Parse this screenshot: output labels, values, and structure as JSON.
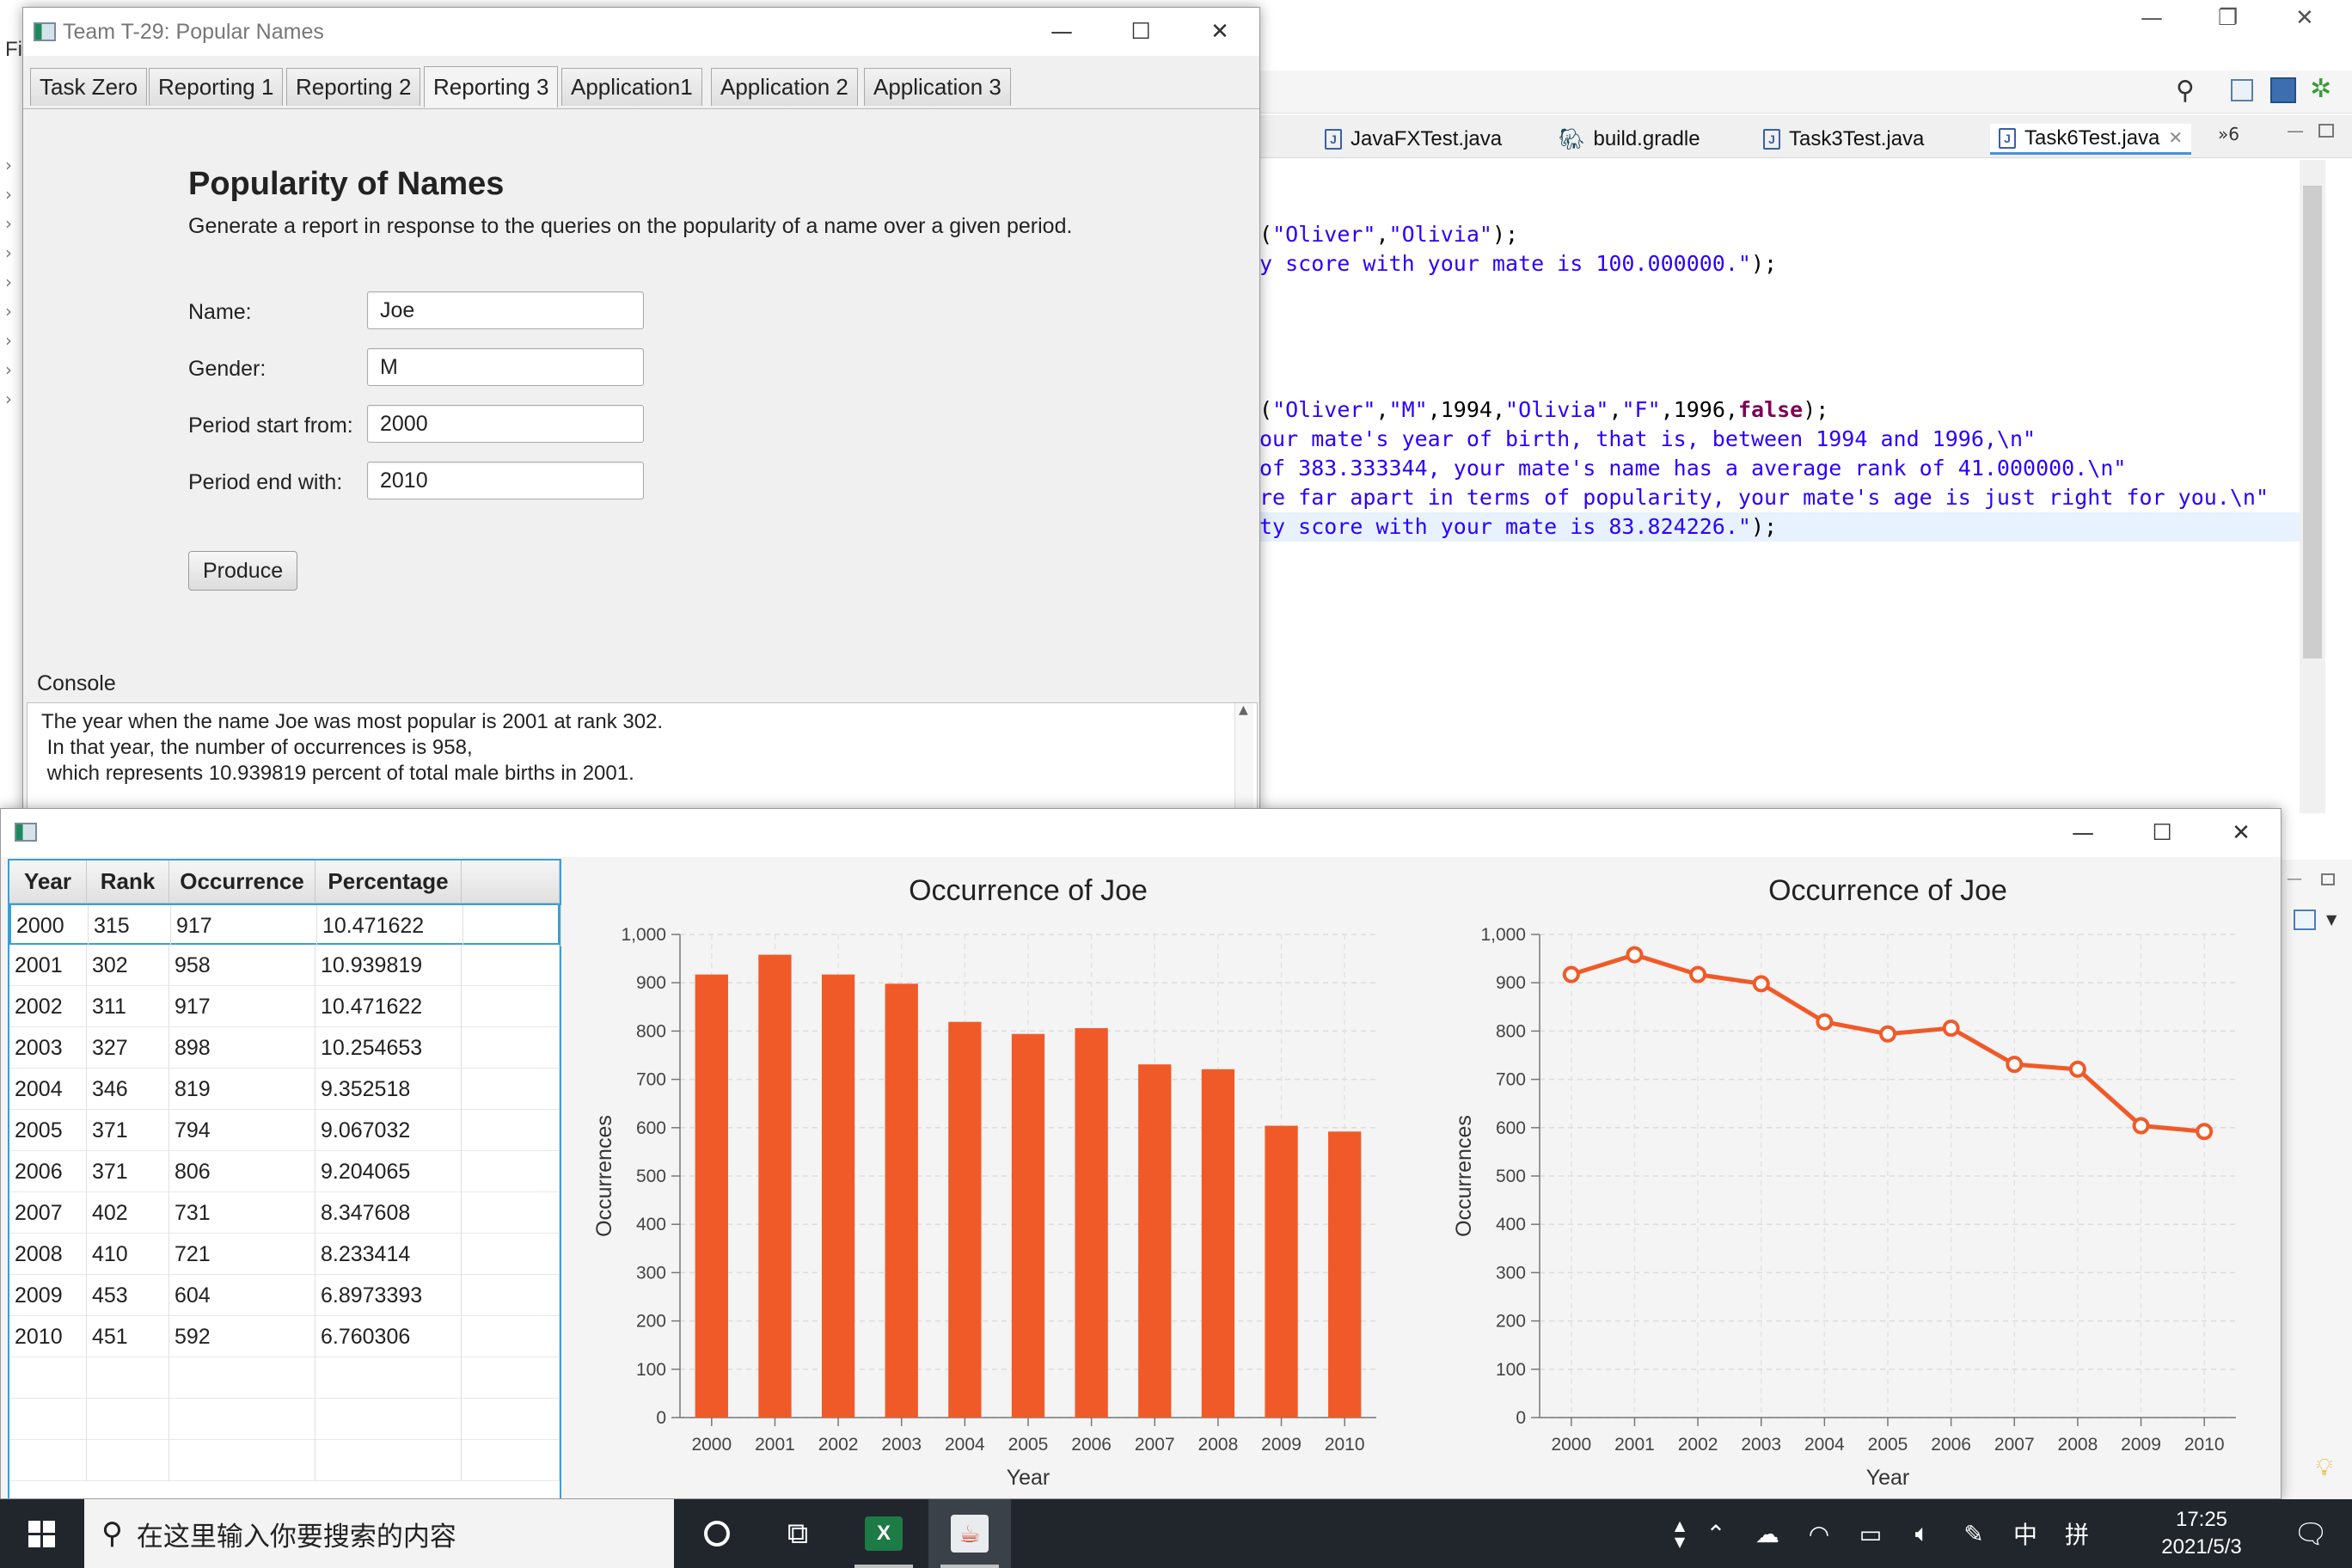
{
  "ide": {
    "window_controls": [
      "—",
      "❐",
      "✕"
    ],
    "menu_fragments": [
      "Fi"
    ],
    "editor_tabs": [
      {
        "label": "JavaFXTest.java",
        "icon": "java-file-icon"
      },
      {
        "label": "build.gradle",
        "icon": "gradle-icon"
      },
      {
        "label": "Task3Test.java",
        "icon": "java-file-icon"
      },
      {
        "label": "Task6Test.java",
        "icon": "java-file-icon",
        "active": true
      }
    ],
    "tab_close": "✕",
    "tab_overflow": "»6",
    "code_lines": [
      {
        "parts": [
          {
            "t": "(",
            "c": "plain"
          },
          {
            "t": "\"Oliver\"",
            "c": "str"
          },
          {
            "t": ",",
            "c": "plain"
          },
          {
            "t": "\"Olivia\"",
            "c": "str"
          },
          {
            "t": ");",
            "c": "plain"
          }
        ]
      },
      {
        "parts": [
          {
            "t": "y score with your mate is 100.000000.\"",
            "c": "str"
          },
          {
            "t": ");",
            "c": "plain"
          }
        ]
      },
      {
        "parts": [
          {
            "t": "(",
            "c": "plain"
          },
          {
            "t": "\"Oliver\"",
            "c": "str"
          },
          {
            "t": ",",
            "c": "plain"
          },
          {
            "t": "\"M\"",
            "c": "str"
          },
          {
            "t": ",1994,",
            "c": "plain"
          },
          {
            "t": "\"Olivia\"",
            "c": "str"
          },
          {
            "t": ",",
            "c": "plain"
          },
          {
            "t": "\"F\"",
            "c": "str"
          },
          {
            "t": ",1996,",
            "c": "plain"
          },
          {
            "t": "false",
            "c": "kw"
          },
          {
            "t": ");",
            "c": "plain"
          }
        ]
      },
      {
        "parts": [
          {
            "t": "our mate's year of birth, that is, between 1994 and 1996,\\n\"",
            "c": "str"
          }
        ]
      },
      {
        "parts": [
          {
            "t": "of 383.333344, your mate's name has a average rank of 41.000000.\\n\"",
            "c": "str"
          }
        ]
      },
      {
        "parts": [
          {
            "t": "re far apart in terms of popularity, your mate's age is just right for you.\\n\"",
            "c": "str"
          }
        ]
      },
      {
        "parts": [
          {
            "t": "ty score with your mate is 83.824226.\"",
            "c": "str"
          },
          {
            "t": ");",
            "c": "plain"
          }
        ]
      }
    ]
  },
  "win1": {
    "title": "Team T-29: Popular Names",
    "controls": {
      "minimize": "—",
      "maximize": "☐",
      "close": "✕"
    },
    "tabs": [
      "Task Zero",
      "Reporting 1",
      "Reporting 2",
      "Reporting 3",
      "Application1",
      "Application 2",
      "Application 3"
    ],
    "active_tab": "Reporting 3",
    "heading": "Popularity of Names",
    "subheading": "Generate a report in response to the queries on the popularity of a name over a given period.",
    "form": {
      "name_label": "Name:",
      "name_value": "Joe",
      "gender_label": "Gender:",
      "gender_value": "M",
      "start_label": "Period start from:",
      "start_value": "2000",
      "end_label": "Period end with:",
      "end_value": "2010"
    },
    "produce_label": "Produce",
    "console_label": "Console",
    "console_lines": [
      "The year when the name Joe was most popular is 2001 at rank 302.",
      " In that year, the number of occurrences is 958,",
      " which represents 10.939819 percent of total male births in 2001."
    ]
  },
  "win2": {
    "controls": {
      "minimize": "—",
      "maximize": "☐",
      "close": "✕"
    },
    "table": {
      "columns": [
        "Year",
        "Rank",
        "Occurrence",
        "Percentage"
      ],
      "rows": [
        [
          "2000",
          "315",
          "917",
          "10.471622"
        ],
        [
          "2001",
          "302",
          "958",
          "10.939819"
        ],
        [
          "2002",
          "311",
          "917",
          "10.471622"
        ],
        [
          "2003",
          "327",
          "898",
          "10.254653"
        ],
        [
          "2004",
          "346",
          "819",
          "9.352518"
        ],
        [
          "2005",
          "371",
          "794",
          "9.067032"
        ],
        [
          "2006",
          "371",
          "806",
          "9.204065"
        ],
        [
          "2007",
          "402",
          "731",
          "8.347608"
        ],
        [
          "2008",
          "410",
          "721",
          "8.233414"
        ],
        [
          "2009",
          "453",
          "604",
          "6.8973393"
        ],
        [
          "2010",
          "451",
          "592",
          "6.760306"
        ]
      ],
      "selected_row": 0
    }
  },
  "chart_data": [
    {
      "type": "bar",
      "title": "Occurrence of Joe",
      "xlabel": "Year",
      "ylabel": "Occurrences",
      "categories": [
        "2000",
        "2001",
        "2002",
        "2003",
        "2004",
        "2005",
        "2006",
        "2007",
        "2008",
        "2009",
        "2010"
      ],
      "values": [
        917,
        958,
        917,
        898,
        819,
        794,
        806,
        731,
        721,
        604,
        592
      ],
      "ylim": [
        0,
        1000
      ],
      "yticks": [
        "0",
        "100",
        "200",
        "300",
        "400",
        "500",
        "600",
        "700",
        "800",
        "900",
        "1,000"
      ],
      "grid": true,
      "color": "#f05a28"
    },
    {
      "type": "line",
      "title": "Occurrence of Joe",
      "xlabel": "Year",
      "ylabel": "Occurrences",
      "categories": [
        "2000",
        "2001",
        "2002",
        "2003",
        "2004",
        "2005",
        "2006",
        "2007",
        "2008",
        "2009",
        "2010"
      ],
      "values": [
        917,
        958,
        917,
        898,
        819,
        794,
        806,
        731,
        721,
        604,
        592
      ],
      "ylim": [
        0,
        1000
      ],
      "yticks": [
        "0",
        "100",
        "200",
        "300",
        "400",
        "500",
        "600",
        "700",
        "800",
        "900",
        "1,000"
      ],
      "grid": true,
      "color": "#f05a28"
    }
  ],
  "taskbar": {
    "search_placeholder": "在这里输入你要搜索的内容",
    "tray": {
      "ime_lang": "中",
      "ime_mode": "拼"
    },
    "clock_time": "17:25",
    "clock_date": "2021/5/3",
    "chevron_up": "⌃",
    "colors": {
      "bar": "#20262c"
    }
  }
}
